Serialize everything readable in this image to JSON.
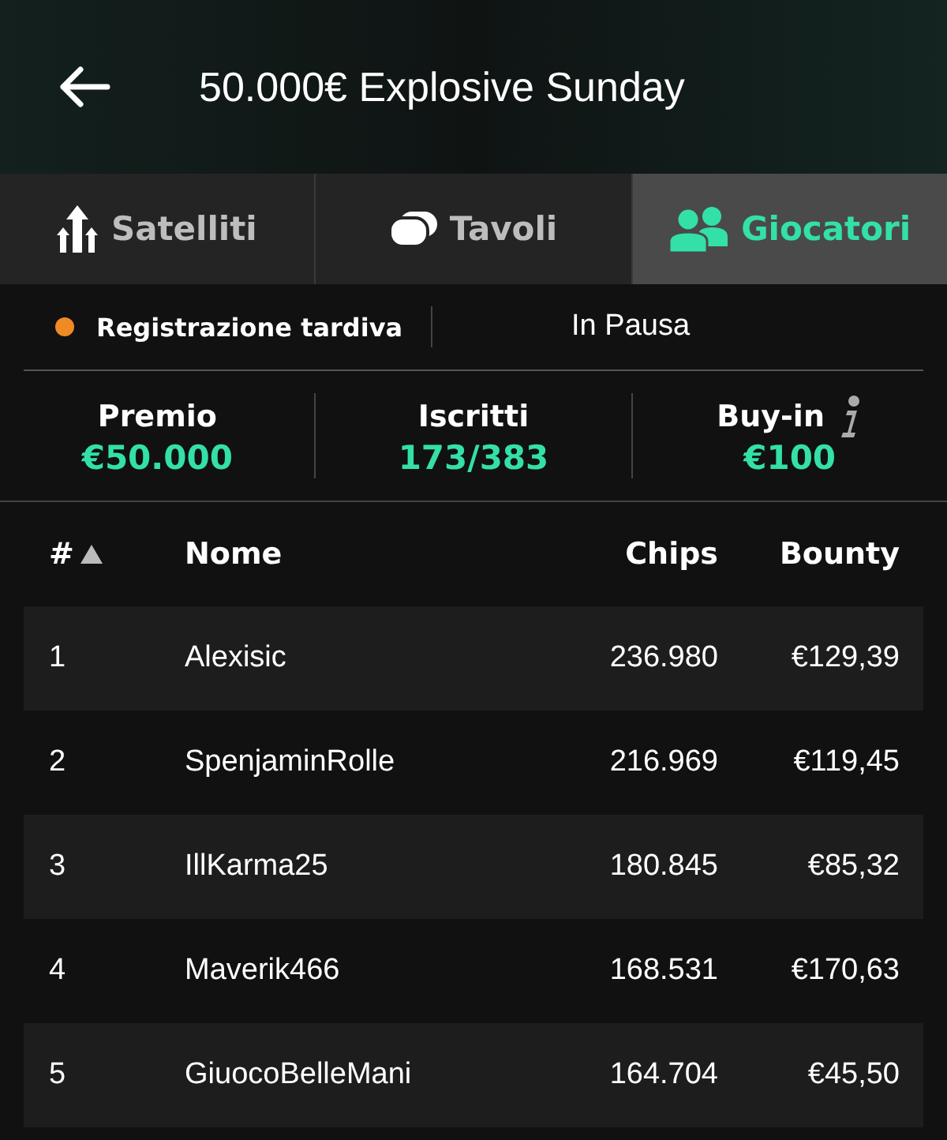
{
  "header": {
    "title": "50.000€ Explosive Sunday"
  },
  "tabs": [
    {
      "label": "Satelliti",
      "kind": "satellites",
      "selected": false
    },
    {
      "label": "Tavoli",
      "kind": "tables",
      "selected": false
    },
    {
      "label": "Giocatori",
      "kind": "players",
      "selected": true
    }
  ],
  "status": {
    "label": "Registrazione tardiva",
    "color": "#f08a24",
    "state": "In Pausa"
  },
  "stats": [
    {
      "label": "Premio",
      "value": "€50.000",
      "info": false
    },
    {
      "label": "Iscritti",
      "value": "173/383",
      "info": false
    },
    {
      "label": "Buy-in",
      "value": "€100",
      "info": true
    }
  ],
  "table": {
    "columns": [
      {
        "label": "#",
        "sorted": true
      },
      {
        "label": "Nome"
      },
      {
        "label": "Chips"
      },
      {
        "label": "Bounty"
      }
    ],
    "rows": [
      [
        "1",
        "Alexisic",
        "236.980",
        "€129,39"
      ],
      [
        "2",
        "SpenjaminRolle",
        "216.969",
        "€119,45"
      ],
      [
        "3",
        "IllKarma25",
        "180.845",
        "€85,32"
      ],
      [
        "4",
        "Maverik466",
        "168.531",
        "€170,63"
      ],
      [
        "5",
        "GiuocoBelleMani",
        "164.704",
        "€45,50"
      ]
    ]
  }
}
